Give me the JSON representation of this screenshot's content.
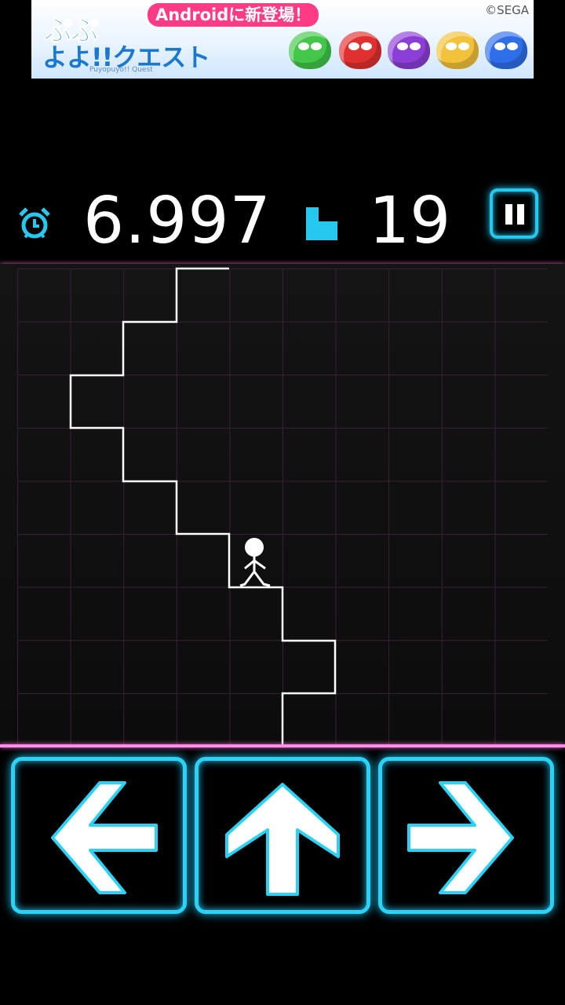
{
  "ad": {
    "logo_line1": "ぷぷ",
    "logo_line2": "よよ!!クエスト",
    "logo_sub": "Puyopuyo!! Quest",
    "headline": "Androidに新登場！",
    "copyright": "©SEGA",
    "puyo_colors": [
      "#43c64a",
      "#e0302f",
      "#8c3fd6",
      "#f2c23a",
      "#2e6ee8"
    ]
  },
  "hud": {
    "timer_value": "6.997",
    "step_count": "19",
    "icons": {
      "timer": "alarm-clock-icon",
      "steps": "stairs-icon",
      "pause": "pause-icon"
    }
  },
  "controls": {
    "left": "arrow-left-icon",
    "up": "arrow-up-icon",
    "right": "arrow-right-icon",
    "accent_color": "#2bd2f5"
  },
  "colors": {
    "background": "#000000",
    "grid_line": "#3a1f35",
    "boundary": "#ff8fe6",
    "staircase": "#ffffff",
    "neon_cyan": "#26c8f0"
  }
}
